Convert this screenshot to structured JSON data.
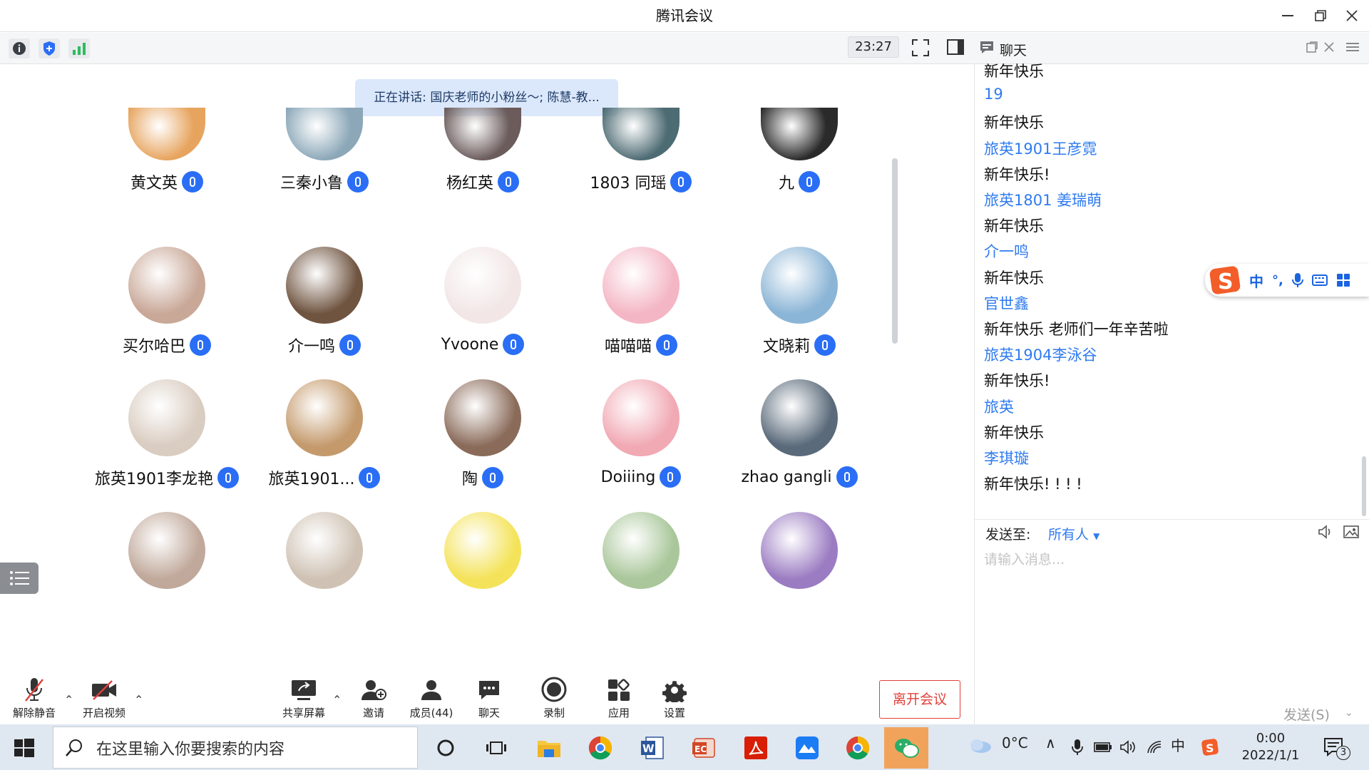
{
  "window": {
    "title": "腾讯会议"
  },
  "toolbar": {
    "timer": "23:27"
  },
  "speaking": {
    "text": "正在讲话: 国庆老师的小粉丝～; 陈慧-教..."
  },
  "participants": [
    {
      "name": "黄文英",
      "color": "#e7a45e"
    },
    {
      "name": "三秦小鲁",
      "color": "#8ba7b8"
    },
    {
      "name": "杨红英",
      "color": "#6b5b5b"
    },
    {
      "name": "1803 同瑶",
      "color": "#4d6b73"
    },
    {
      "name": "九",
      "color": "#2a2a2a"
    },
    {
      "name": "买尔哈巴",
      "color": "#c9a898"
    },
    {
      "name": "介一鸣",
      "color": "#6f5440"
    },
    {
      "name": "Yvoone",
      "color": "#f2e6e6"
    },
    {
      "name": "喵喵喵",
      "color": "#f4b6c4"
    },
    {
      "name": "文晓莉",
      "color": "#8bb5d6"
    },
    {
      "name": "旅英1901李龙艳",
      "color": "#d9ccc0"
    },
    {
      "name": "旅英1901...",
      "color": "#c49a6c"
    },
    {
      "name": "陶",
      "color": "#8a6b5a"
    },
    {
      "name": "Doiiing",
      "color": "#f1a9b4"
    },
    {
      "name": "zhao gangli",
      "color": "#5a6a7a"
    },
    {
      "name": "",
      "color": "#c0a89a"
    },
    {
      "name": "",
      "color": "#cfc2b4"
    },
    {
      "name": "",
      "color": "#f4e35a"
    },
    {
      "name": "",
      "color": "#a9c79a"
    },
    {
      "name": "",
      "color": "#9b7cc2"
    }
  ],
  "controls": {
    "unmute": "解除静音",
    "video": "开启视频",
    "share": "共享屏幕",
    "invite": "邀请",
    "members": "成员(44)",
    "chat": "聊天",
    "record": "录制",
    "apps": "应用",
    "settings": "设置",
    "leave": "离开会议"
  },
  "chat": {
    "title": "聊天",
    "messages": [
      {
        "type": "text",
        "content": "新年快乐"
      },
      {
        "type": "sender",
        "content": "19"
      },
      {
        "type": "text",
        "content": "新年快乐"
      },
      {
        "type": "sender",
        "content": "旅英1901王彦霓"
      },
      {
        "type": "text",
        "content": "新年快乐!"
      },
      {
        "type": "sender",
        "content": "旅英1801 姜瑞萌"
      },
      {
        "type": "text",
        "content": "新年快乐"
      },
      {
        "type": "sender",
        "content": "介一鸣"
      },
      {
        "type": "text",
        "content": "新年快乐"
      },
      {
        "type": "sender",
        "content": "官世鑫"
      },
      {
        "type": "text",
        "content": "新年快乐 老师们一年辛苦啦"
      },
      {
        "type": "sender",
        "content": "旅英1904李泳谷"
      },
      {
        "type": "text",
        "content": "新年快乐!"
      },
      {
        "type": "sender",
        "content": "旅英"
      },
      {
        "type": "text",
        "content": "新年快乐"
      },
      {
        "type": "sender",
        "content": "李琪璇"
      },
      {
        "type": "text",
        "content": "新年快乐! ! ! !"
      }
    ],
    "send_to_label": "发送至:",
    "send_to_value": "所有人",
    "placeholder": "请输入消息...",
    "send_label": "发送(S)"
  },
  "ime": {
    "mode": "中",
    "punct": "°,"
  },
  "taskbar": {
    "search_placeholder": "在这里输入你要搜索的内容",
    "weather": "0°C",
    "lang": "中",
    "time": "0:00",
    "date": "2022/1/1",
    "notifications": "3"
  }
}
